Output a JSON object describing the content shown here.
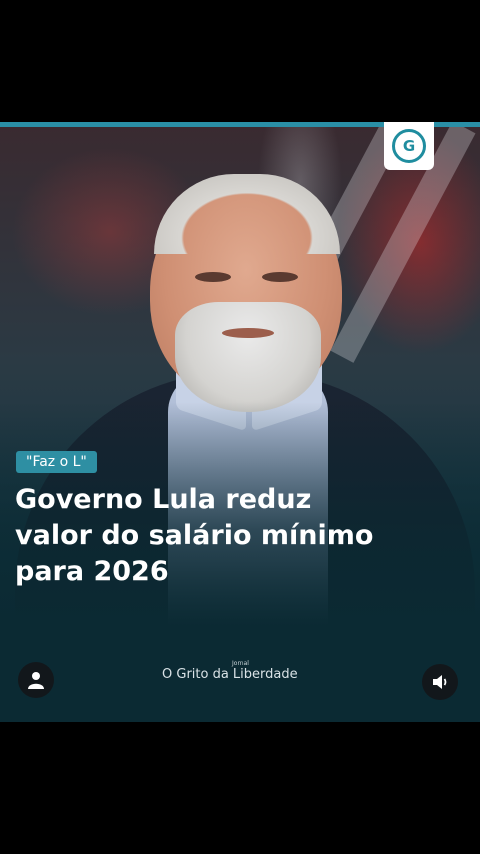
{
  "post": {
    "tag": "\"Faz o L\"",
    "headline_lines": [
      "Governo Lula reduz",
      "valor do salário mínimo",
      "para 2026"
    ],
    "brand_small": "Jornal",
    "brand_main": "O Grito da Liberdade",
    "logo_letter": "G"
  },
  "controls": {
    "user_icon": "user-icon",
    "sound_icon": "speaker-icon"
  },
  "colors": {
    "accent": "#2e8fa3",
    "background": "#0b2a33"
  }
}
